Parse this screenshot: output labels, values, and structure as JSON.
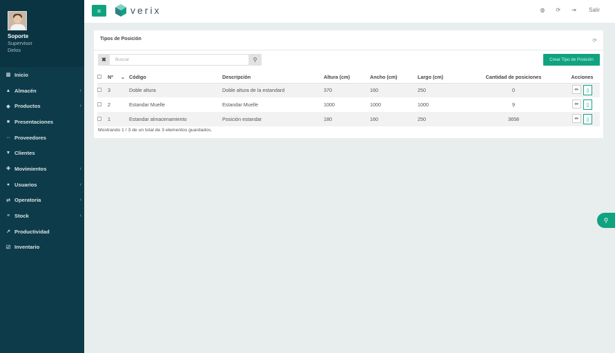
{
  "profile": {
    "name": "Soporte",
    "role": "Supervisor",
    "company": "Delos"
  },
  "sidebar": {
    "items": [
      {
        "label": "Inicio",
        "icon": "chart-icon",
        "glyph": "▥",
        "has_children": false
      },
      {
        "label": "Almacén",
        "icon": "warehouse-icon",
        "glyph": "▲",
        "has_children": true
      },
      {
        "label": "Productos",
        "icon": "cubes-icon",
        "glyph": "◆",
        "has_children": true
      },
      {
        "label": "Presentaciones",
        "icon": "box-icon",
        "glyph": "■",
        "has_children": false
      },
      {
        "label": "Proveedores",
        "icon": "handshake-icon",
        "glyph": "⇔",
        "has_children": false
      },
      {
        "label": "Clientes",
        "icon": "user-icon",
        "glyph": "▼",
        "has_children": false
      },
      {
        "label": "Movimientos",
        "icon": "arrows-icon",
        "glyph": "✚",
        "has_children": true
      },
      {
        "label": "Usuarios",
        "icon": "users-icon",
        "glyph": "●",
        "has_children": true
      },
      {
        "label": "Operatoria",
        "icon": "exchange-icon",
        "glyph": "⇄",
        "has_children": true
      },
      {
        "label": "Stock",
        "icon": "database-icon",
        "glyph": "≡",
        "has_children": true
      },
      {
        "label": "Productividad",
        "icon": "line-chart-icon",
        "glyph": "↗",
        "has_children": false
      },
      {
        "label": "Inventario",
        "icon": "checklist-icon",
        "glyph": "☑",
        "has_children": false
      }
    ]
  },
  "topbar": {
    "brand": "verix",
    "logout_label": "Salir"
  },
  "panel": {
    "title": "Tipos de Posición",
    "search_placeholder": "Buscar",
    "create_label": "Crear Tipo de Posición",
    "footer": "Mostrando 1 / 3 de un total de 3 elementos guardados."
  },
  "table": {
    "headers": [
      "Nº",
      "Código",
      "Descripción",
      "Altura (cm)",
      "Ancho (cm)",
      "Largo (cm)",
      "Cantidad de posiciones",
      "Acciones"
    ],
    "rows": [
      {
        "n": "3",
        "codigo": "Doble altura",
        "descripcion": "Doble altura de la estandard",
        "altura": "370",
        "ancho": "160",
        "largo": "250",
        "cantidad": "0"
      },
      {
        "n": "2",
        "codigo": "Estandar Muelle",
        "descripcion": "Estandar Muelle",
        "altura": "1000",
        "ancho": "1000",
        "largo": "1000",
        "cantidad": "9"
      },
      {
        "n": "1",
        "codigo": "Estandar almacenamiento",
        "descripcion": "Posición estandar",
        "altura": "180",
        "ancho": "160",
        "largo": "250",
        "cantidad": "3658"
      }
    ]
  },
  "colors": {
    "accent": "#10a37f",
    "sidebar": "#0e3b4a"
  }
}
